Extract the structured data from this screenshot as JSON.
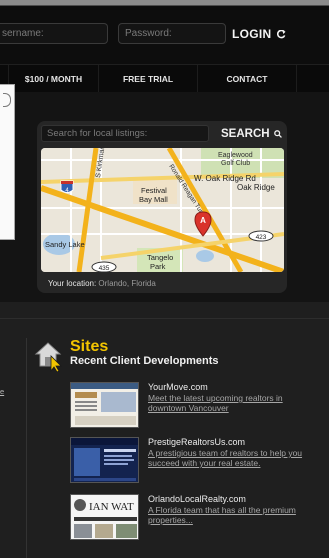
{
  "header": {
    "username_placeholder": "sername:",
    "password_placeholder": "Password:",
    "login_label": "LOGIN"
  },
  "nav": {
    "items": [
      {
        "label": "$100 / MONTH"
      },
      {
        "label": "FREE TRIAL"
      },
      {
        "label": "CONTACT"
      }
    ]
  },
  "search": {
    "placeholder": "Search for local listings:",
    "button_label": "SEARCH"
  },
  "map": {
    "labels": {
      "eaglewood": "Eaglewood",
      "golf_club": "Golf Club",
      "oak_ridge_rd": "W. Oak Ridge Rd",
      "oak_ridge": "Oak Ridge",
      "festival1": "Festival",
      "festival2": "Bay Mall",
      "sandy_lake": "Sandy Lake",
      "tangelo1": "Tangelo",
      "tangelo2": "Park",
      "shield_4": "4",
      "shield_435": "435",
      "shield_423": "423",
      "marker": "A",
      "kirkman": "S Kirkman",
      "turnpike": "Ronald Reagan Turnpike",
      "florida_turnpike": "Florida Turnpike"
    }
  },
  "location": {
    "label": "Your location:",
    "city": "Orlando, Florida"
  },
  "left_link": "e",
  "sites": {
    "title": "Sites",
    "subtitle": "Recent Client Developments",
    "items": [
      {
        "name": "YourMove.com",
        "desc": "Meet the latest upcoming realtors in downtown Vancouver"
      },
      {
        "name": "PrestigeRealtorsUs.com",
        "desc": "A prestigious team of realtors to help you succeed with your real estate."
      },
      {
        "name": "OrlandoLocalRealty.com",
        "desc": "A Florida team that has all the premium properties..."
      }
    ],
    "thumb_texts": {
      "ian": "IAN WAT"
    }
  },
  "colors": {
    "accent_yellow": "#f2c400",
    "map_road_orange": "#f3b21b",
    "map_marker_red": "#d9332b"
  }
}
